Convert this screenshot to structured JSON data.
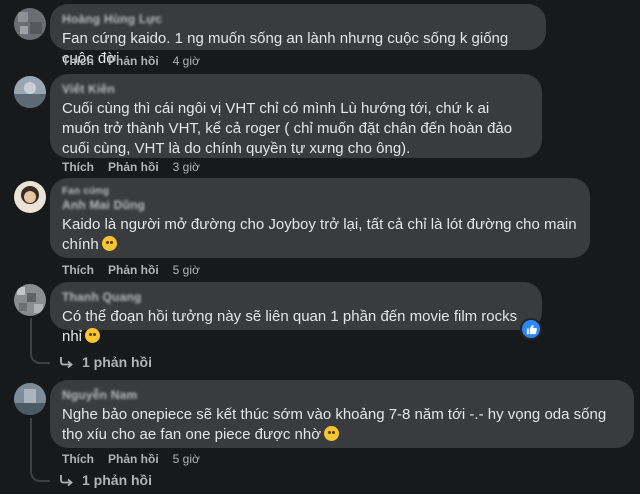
{
  "actions": {
    "like": "Thích",
    "reply": "Phản hồi"
  },
  "comments": [
    {
      "author": "Hoàng Hùng Lực",
      "text": "Fan cứng kaido. 1 ng muốn sống an lành nhưng cuộc sống k giống cuộc đời",
      "time": "4 giờ"
    },
    {
      "author": "Viết Kiên",
      "text": "Cuối cùng thì cái ngôi vị VHT chỉ có mình Lù hướng tới, chứ k ai muốn trở thành VHT, kể cả roger ( chỉ muốn đặt chân đến hoàn đảo cuối cùng, VHT là do chính quyền tự xưng cho ông).",
      "time": "3 giờ"
    },
    {
      "author_top": "Fan cứng",
      "author": "Anh Mai Dũng",
      "text": "Kaido là người mở đường cho Joyboy trở lại, tất cả chỉ là lót đường cho main chính",
      "emoji": "rofl-emoji",
      "time": "5 giờ"
    },
    {
      "author": "Thanh Quang",
      "text": "Có thể đoạn hồi tưởng này sẽ liên quan 1 phần đến movie film rocks nhỉ",
      "emoji": "smirk-emoji",
      "time": "",
      "replies": "1 phản hồi"
    },
    {
      "author": "Nguyễn Nam",
      "text": "Nghe bảo onepiece sẽ kết thúc sớm vào khoảng 7-8 năm tới -.- hy vọng oda sống thọ xíu cho ae fan one piece được nhờ",
      "emoji": "worried-emoji",
      "time": "5 giờ",
      "replies": "1 phản hồi"
    }
  ]
}
